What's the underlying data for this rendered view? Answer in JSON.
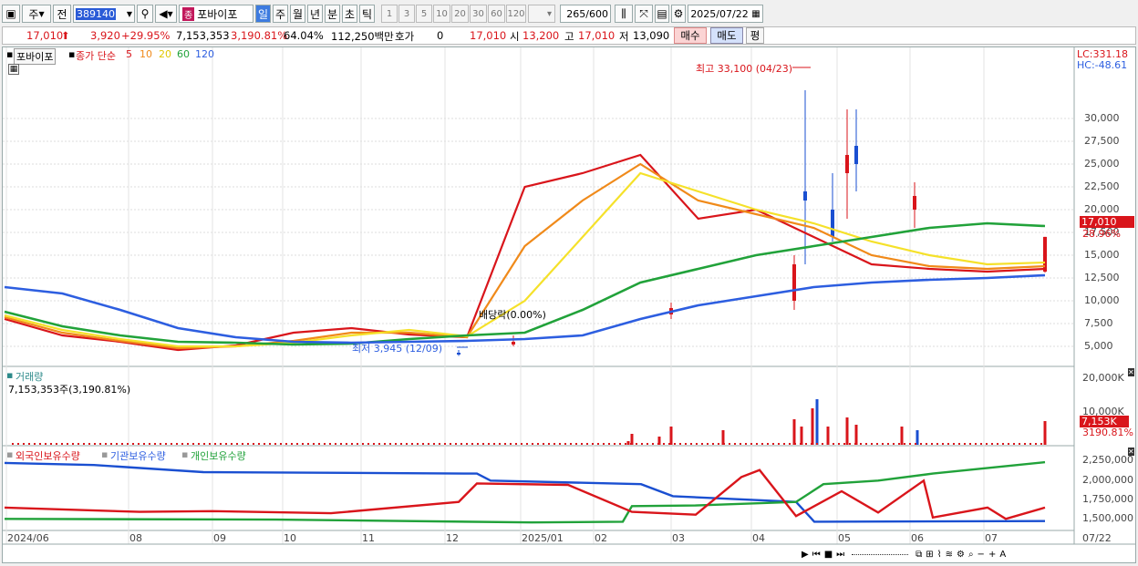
{
  "toolbar": {
    "type": "주",
    "prev": "전",
    "code": "389140",
    "stock_name": "포바이포",
    "badge": "종",
    "periods": [
      "일",
      "주",
      "월",
      "년",
      "분",
      "초",
      "틱"
    ],
    "intervals": [
      "1",
      "3",
      "5",
      "10",
      "20",
      "30",
      "60",
      "120"
    ],
    "count": "265",
    "count_total": "/600",
    "date": "2025/07/22"
  },
  "info": {
    "price": "17,010",
    "change": "3,920",
    "change_pct": "+29.95%",
    "volume": "7,153,353",
    "volume_ratio": "3,190.81%",
    "turnover_rate": "64.04%",
    "amount": "112,250백만",
    "hoga_label": "호가",
    "hoga": "0",
    "current": "17,010",
    "open_label": "시",
    "open": "13,200",
    "high_label": "고",
    "high": "17,010",
    "low_label": "저",
    "low": "13,090",
    "buy": "매수",
    "sell": "매도",
    "eval": "평"
  },
  "chart": {
    "stock_name": "포바이포",
    "ma_title": "종가 단순",
    "ma_periods": [
      "5",
      "10",
      "20",
      "60",
      "120"
    ],
    "lc": "LC:331.18",
    "hc": "HC:-48.61",
    "high_note": "최고 33,100 (04/23)",
    "low_note": "최저 3,945 (12/09)",
    "dividend": "배당락(0.00%)",
    "price_ticks": [
      "30,000",
      "27,500",
      "25,000",
      "22,500",
      "20,000",
      "17,500",
      "15,000",
      "12,500",
      "10,000",
      "7,500",
      "5,000"
    ],
    "cur_label": "17,010",
    "cur_pct": "28.96%"
  },
  "volume": {
    "title": "거래량",
    "value": "7,153,353주(3,190.81%)",
    "ticks": [
      "20,000K",
      "10,000K"
    ],
    "cur": "7,153K",
    "pct": "3190.81%"
  },
  "holdings": {
    "legend": [
      "외국인보유수량",
      "기관보유수량",
      "개인보유수량"
    ],
    "ticks": [
      "2,250,000",
      "2,000,000",
      "1,750,000",
      "1,500,000"
    ]
  },
  "xaxis": {
    "labels": [
      "2024/06",
      "08",
      "09",
      "10",
      "11",
      "12",
      "2025/01",
      "02",
      "03",
      "04",
      "05",
      "06",
      "07"
    ],
    "right": "07/22"
  },
  "colors": {
    "up": "#d9151b",
    "down": "#1a4fd1",
    "ma5": "#d9151b",
    "ma10": "#f08a1a",
    "ma20": "#f5e12a",
    "ma60": "#21a23a",
    "ma120": "#2d5ee0"
  },
  "chart_data": {
    "type": "line",
    "series": [
      {
        "name": "5",
        "values": [
          8000,
          6200,
          5500,
          4600,
          5100,
          6500,
          7000,
          6300,
          6000,
          22500,
          24000,
          26000,
          19000,
          20000,
          17000,
          14000,
          13500,
          13200,
          13500
        ]
      },
      {
        "name": "10",
        "values": [
          8200,
          6500,
          5600,
          4800,
          5000,
          5600,
          6500,
          6500,
          6000,
          16000,
          21000,
          25000,
          21000,
          19500,
          18000,
          15000,
          13800,
          13500,
          13800
        ]
      },
      {
        "name": "20",
        "values": [
          8400,
          6800,
          5800,
          5000,
          5000,
          5400,
          6200,
          6800,
          6100,
          10000,
          17000,
          24000,
          22000,
          20000,
          18500,
          16500,
          15000,
          14000,
          14200
        ]
      },
      {
        "name": "60",
        "values": [
          8800,
          7200,
          6200,
          5500,
          5400,
          5200,
          5300,
          5800,
          6200,
          6500,
          9000,
          12000,
          13500,
          15000,
          16000,
          17000,
          18000,
          18500,
          18200
        ]
      },
      {
        "name": "120",
        "values": [
          11500,
          10800,
          9000,
          7000,
          6000,
          5500,
          5400,
          5500,
          5600,
          5800,
          6200,
          8000,
          9500,
          10500,
          11500,
          12000,
          12300,
          12500,
          12800
        ]
      }
    ],
    "ylim": [
      3000,
      33000
    ]
  }
}
